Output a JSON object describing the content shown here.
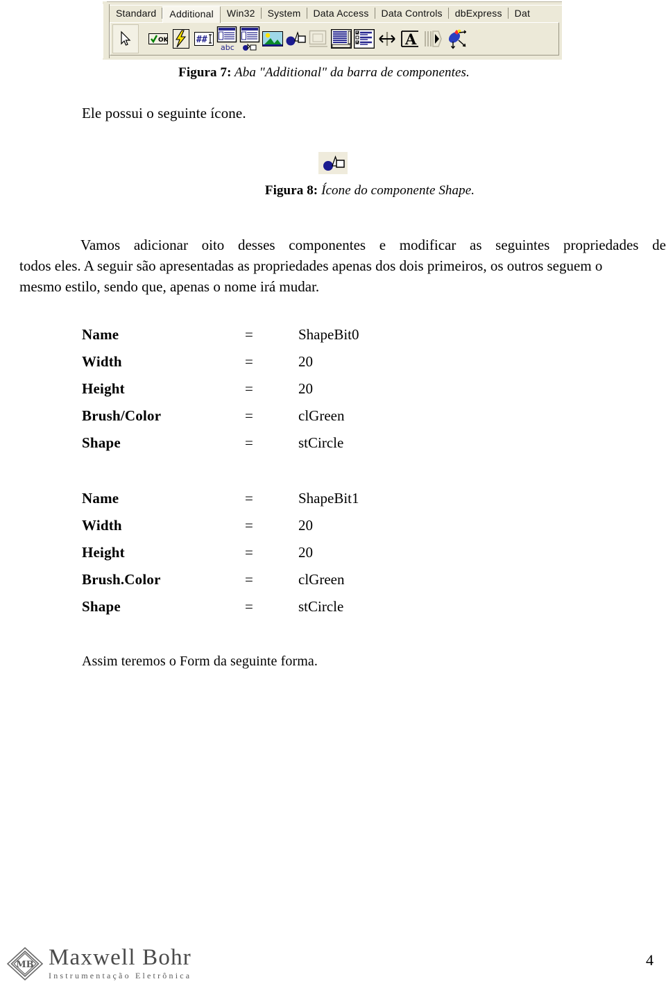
{
  "figure7": {
    "caption_prefix": "Figura 7:",
    "caption_text": " Aba \"Additional\" da barra de componentes.",
    "palette": {
      "tabs": [
        {
          "label": "Standard",
          "active": false
        },
        {
          "label": "Additional",
          "active": true
        },
        {
          "label": "Win32",
          "active": false
        },
        {
          "label": "System",
          "active": false
        },
        {
          "label": "Data Access",
          "active": false
        },
        {
          "label": "Data Controls",
          "active": false
        },
        {
          "label": "dbExpress",
          "active": false
        },
        {
          "label": "Dat",
          "active": false
        }
      ],
      "icons": [
        {
          "name": "pointer-icon",
          "label": "Pointer"
        },
        {
          "name": "bitbtn-icon",
          "label": "BitBtn"
        },
        {
          "name": "speedbutton-icon",
          "label": "SpeedButton"
        },
        {
          "name": "maskedit-icon",
          "label": "MaskEdit"
        },
        {
          "name": "stringgrid-icon",
          "label": "StringGrid"
        },
        {
          "name": "drawgrid-icon",
          "label": "DrawGrid"
        },
        {
          "name": "image-icon",
          "label": "Image"
        },
        {
          "name": "shape-icon",
          "label": "Shape"
        },
        {
          "name": "bevel-icon",
          "label": "Bevel"
        },
        {
          "name": "scrollbox-icon",
          "label": "ScrollBox"
        },
        {
          "name": "checklistbox-icon",
          "label": "CheckListBox"
        },
        {
          "name": "splitter-icon",
          "label": "Splitter"
        },
        {
          "name": "statictext-icon",
          "label": "StaticText"
        },
        {
          "name": "controlbar-icon",
          "label": "ControlBar"
        },
        {
          "name": "applicationevents-icon",
          "label": "ApplicationEvents"
        }
      ],
      "colors": {
        "background": "#ece9d8",
        "active_tab": "#f7f5ec",
        "shape_blue": "#1b1b8f",
        "grid_blue": "#26268f"
      }
    }
  },
  "intro": {
    "line": "Ele possui o seguinte ícone."
  },
  "figure8": {
    "caption_prefix": "Figura 8:",
    "caption_text": " Ícone do componente Shape.",
    "icon_name": "shape-component-icon",
    "icon_background": "#efebdc",
    "icon_circle_color": "#1b1b8f"
  },
  "paragraph": {
    "line1_a": "Vamos",
    "line1_b": "adicionar",
    "line1_c": "oito",
    "line1_d": "desses",
    "line1_e": "componentes",
    "line1_f": "e",
    "line1_g": "modificar",
    "line1_h": "as",
    "line1_i": "seguintes",
    "line1_j": "propriedades",
    "line1_k": "de",
    "line2": "todos eles. A seguir são apresentadas as propriedades apenas dos dois primeiros, os outros seguem o",
    "line3": "mesmo estilo, sendo que, apenas o nome irá mudar."
  },
  "properties": [
    {
      "id": "shapebit0",
      "rows": [
        {
          "key": "Name",
          "eq": "=",
          "value": "ShapeBit0"
        },
        {
          "key": "Width",
          "eq": "=",
          "value": "20"
        },
        {
          "key": "Height",
          "eq": "=",
          "value": "20"
        },
        {
          "key": "Brush/Color",
          "eq": "=",
          "value": "clGreen"
        },
        {
          "key": "Shape",
          "eq": "=",
          "value": "stCircle"
        }
      ]
    },
    {
      "id": "shapebit1",
      "rows": [
        {
          "key": "Name",
          "eq": "=",
          "value": "ShapeBit1"
        },
        {
          "key": "Width",
          "eq": "=",
          "value": "20"
        },
        {
          "key": "Height",
          "eq": "=",
          "value": "20"
        },
        {
          "key": "Brush.Color",
          "eq": "=",
          "value": "clGreen"
        },
        {
          "key": "Shape",
          "eq": "=",
          "value": "stCircle"
        }
      ]
    }
  ],
  "closing": {
    "line": "Assim teremos o Form da seguinte forma."
  },
  "footer": {
    "logo_title": "Maxwell Bohr",
    "logo_subtitle": "Instrumentação Eletrônica",
    "logo_monogram": "MB",
    "page_number": "4"
  }
}
